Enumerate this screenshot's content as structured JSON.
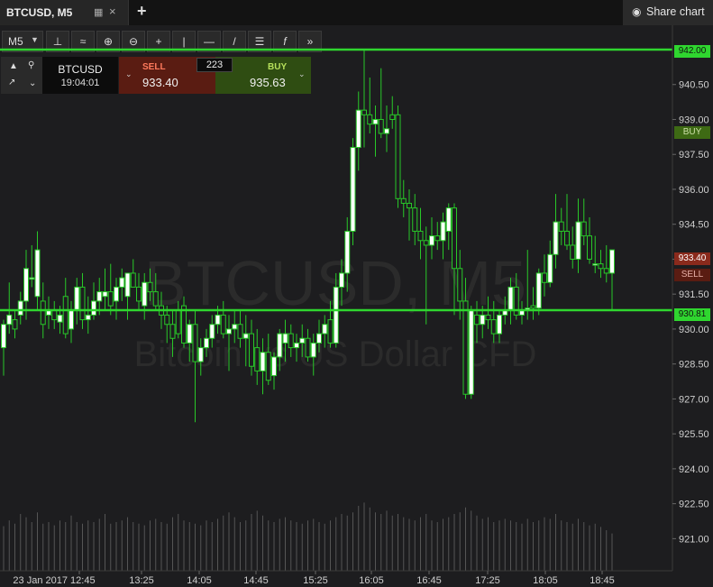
{
  "tab": {
    "title": "BTCUSD, M5",
    "grid_icon": "grid-icon",
    "close_label": "×"
  },
  "add_tab_label": "+",
  "share": {
    "icon": "camera-icon",
    "label": "Share chart"
  },
  "toolbar": {
    "timeframe": "M5",
    "tools": [
      "crosshair-axes-icon",
      "indicator-icon",
      "zoom-in-icon",
      "zoom-out-icon",
      "crosshair-icon",
      "vertical-line-icon",
      "horizontal-line-icon",
      "trend-line-icon",
      "fibonacci-icon",
      "function-icon",
      "fast-forward-icon"
    ]
  },
  "trade_panel": {
    "symbol": "BTCUSD",
    "time": "19:04:01",
    "sell_label": "SELL",
    "sell_price": "933.40",
    "buy_label": "BUY",
    "buy_price": "935.63",
    "spread": "223"
  },
  "watermark": {
    "line1": "BTCUSD, M5",
    "line2": "Bitcoin vs US Dollar CFD"
  },
  "colors": {
    "up": "#ffffff",
    "down": "#1d1d1f",
    "wick": "#28c828",
    "hline": "#2fd62f",
    "sell": "#8a2a1c",
    "buy": "#3e6a14",
    "background": "#1d1d1f"
  },
  "axis_tags": {
    "top": "942.00",
    "buy": "BUY",
    "sell_price": "933.40",
    "sell": "SELL",
    "bottom": "930.81"
  },
  "chart_data": {
    "type": "candlestick",
    "symbol": "BTCUSD, M5",
    "ylim": [
      920.4,
      943.0
    ],
    "y_ticks": [
      "940.50",
      "939.00",
      "937.50",
      "936.00",
      "934.50",
      "933.00",
      "931.50",
      "930.00",
      "928.50",
      "927.00",
      "925.50",
      "924.00",
      "922.50",
      "921.00"
    ],
    "x_ticks": [
      "23 Jan 2017 12:45",
      "13:25",
      "14:05",
      "14:45",
      "15:25",
      "16:05",
      "16:45",
      "17:25",
      "18:05",
      "18:45"
    ],
    "horizontal_lines": [
      942.0,
      930.81
    ],
    "candles": [
      {
        "o": 929.2,
        "h": 930.4,
        "l": 928.0,
        "c": 930.2
      },
      {
        "o": 930.2,
        "h": 932.0,
        "l": 929.8,
        "c": 930.6
      },
      {
        "o": 930.4,
        "h": 930.8,
        "l": 929.6,
        "c": 930.0
      },
      {
        "o": 930.6,
        "h": 931.6,
        "l": 930.2,
        "c": 931.2
      },
      {
        "o": 931.2,
        "h": 933.4,
        "l": 930.4,
        "c": 932.6
      },
      {
        "o": 932.2,
        "h": 933.6,
        "l": 931.8,
        "c": 932.2
      },
      {
        "o": 931.4,
        "h": 934.2,
        "l": 930.8,
        "c": 933.4
      },
      {
        "o": 931.2,
        "h": 932.0,
        "l": 929.6,
        "c": 930.2
      },
      {
        "o": 930.6,
        "h": 931.4,
        "l": 930.0,
        "c": 930.8
      },
      {
        "o": 930.8,
        "h": 931.2,
        "l": 930.0,
        "c": 930.4
      },
      {
        "o": 930.3,
        "h": 931.0,
        "l": 929.8,
        "c": 930.6
      },
      {
        "o": 931.4,
        "h": 932.2,
        "l": 929.6,
        "c": 929.8
      },
      {
        "o": 930.0,
        "h": 931.2,
        "l": 929.4,
        "c": 930.8
      },
      {
        "o": 930.8,
        "h": 932.2,
        "l": 930.2,
        "c": 931.8
      },
      {
        "o": 931.8,
        "h": 932.4,
        "l": 930.0,
        "c": 930.4
      },
      {
        "o": 930.4,
        "h": 931.4,
        "l": 929.8,
        "c": 930.6
      },
      {
        "o": 930.6,
        "h": 932.0,
        "l": 930.4,
        "c": 931.2
      },
      {
        "o": 931.2,
        "h": 932.2,
        "l": 930.6,
        "c": 931.6
      },
      {
        "o": 931.4,
        "h": 932.6,
        "l": 930.8,
        "c": 931.6
      },
      {
        "o": 931.6,
        "h": 932.8,
        "l": 930.6,
        "c": 931.0
      },
      {
        "o": 931.2,
        "h": 932.2,
        "l": 930.4,
        "c": 931.8
      },
      {
        "o": 931.8,
        "h": 932.6,
        "l": 931.2,
        "c": 932.2
      },
      {
        "o": 931.4,
        "h": 932.0,
        "l": 930.4,
        "c": 932.4
      },
      {
        "o": 932.4,
        "h": 933.0,
        "l": 931.8,
        "c": 931.8
      },
      {
        "o": 931.8,
        "h": 932.4,
        "l": 930.8,
        "c": 931.2
      },
      {
        "o": 931.0,
        "h": 932.4,
        "l": 930.4,
        "c": 932.0
      },
      {
        "o": 932.0,
        "h": 932.6,
        "l": 931.2,
        "c": 931.6
      },
      {
        "o": 931.6,
        "h": 932.4,
        "l": 930.8,
        "c": 931.0
      },
      {
        "o": 931.0,
        "h": 931.6,
        "l": 930.0,
        "c": 930.6
      },
      {
        "o": 930.6,
        "h": 931.0,
        "l": 929.4,
        "c": 930.2
      },
      {
        "o": 930.2,
        "h": 930.8,
        "l": 928.8,
        "c": 929.6
      },
      {
        "o": 930.8,
        "h": 931.2,
        "l": 929.6,
        "c": 929.8
      },
      {
        "o": 931.0,
        "h": 931.4,
        "l": 929.2,
        "c": 929.4
      },
      {
        "o": 929.4,
        "h": 930.4,
        "l": 928.6,
        "c": 930.2
      },
      {
        "o": 930.2,
        "h": 930.8,
        "l": 926.0,
        "c": 928.6
      },
      {
        "o": 928.6,
        "h": 929.6,
        "l": 928.0,
        "c": 929.2
      },
      {
        "o": 929.2,
        "h": 930.0,
        "l": 928.8,
        "c": 929.6
      },
      {
        "o": 929.6,
        "h": 930.6,
        "l": 929.2,
        "c": 930.2
      },
      {
        "o": 930.2,
        "h": 931.0,
        "l": 929.8,
        "c": 930.6
      },
      {
        "o": 930.6,
        "h": 931.2,
        "l": 929.6,
        "c": 929.8
      },
      {
        "o": 929.8,
        "h": 930.6,
        "l": 928.2,
        "c": 930.0
      },
      {
        "o": 930.0,
        "h": 930.8,
        "l": 929.4,
        "c": 930.2
      },
      {
        "o": 930.2,
        "h": 930.8,
        "l": 929.2,
        "c": 929.6
      },
      {
        "o": 929.6,
        "h": 930.6,
        "l": 928.4,
        "c": 929.8
      },
      {
        "o": 929.8,
        "h": 930.4,
        "l": 928.0,
        "c": 928.4
      },
      {
        "o": 929.2,
        "h": 930.0,
        "l": 927.6,
        "c": 928.2
      },
      {
        "o": 928.2,
        "h": 929.6,
        "l": 927.2,
        "c": 929.0
      },
      {
        "o": 929.0,
        "h": 929.8,
        "l": 927.6,
        "c": 927.8
      },
      {
        "o": 928.0,
        "h": 929.0,
        "l": 927.4,
        "c": 928.8
      },
      {
        "o": 928.8,
        "h": 930.0,
        "l": 928.2,
        "c": 929.8
      },
      {
        "o": 929.4,
        "h": 930.4,
        "l": 928.6,
        "c": 929.8
      },
      {
        "o": 929.8,
        "h": 930.2,
        "l": 928.8,
        "c": 929.2
      },
      {
        "o": 929.2,
        "h": 929.8,
        "l": 928.6,
        "c": 929.4
      },
      {
        "o": 929.4,
        "h": 930.2,
        "l": 928.8,
        "c": 929.6
      },
      {
        "o": 929.6,
        "h": 930.0,
        "l": 928.6,
        "c": 928.8
      },
      {
        "o": 928.8,
        "h": 929.8,
        "l": 928.0,
        "c": 929.4
      },
      {
        "o": 929.4,
        "h": 930.4,
        "l": 929.0,
        "c": 929.8
      },
      {
        "o": 929.8,
        "h": 930.6,
        "l": 929.2,
        "c": 930.2
      },
      {
        "o": 930.4,
        "h": 931.2,
        "l": 929.2,
        "c": 929.4
      },
      {
        "o": 929.4,
        "h": 932.4,
        "l": 929.2,
        "c": 931.8
      },
      {
        "o": 931.8,
        "h": 933.0,
        "l": 931.0,
        "c": 932.4
      },
      {
        "o": 932.4,
        "h": 934.8,
        "l": 931.6,
        "c": 934.2
      },
      {
        "o": 934.2,
        "h": 938.2,
        "l": 933.6,
        "c": 937.8
      },
      {
        "o": 937.8,
        "h": 940.2,
        "l": 936.8,
        "c": 939.4
      },
      {
        "o": 939.4,
        "h": 942.0,
        "l": 937.8,
        "c": 939.2
      },
      {
        "o": 939.2,
        "h": 940.8,
        "l": 938.4,
        "c": 938.8
      },
      {
        "o": 938.8,
        "h": 939.6,
        "l": 937.4,
        "c": 939.0
      },
      {
        "o": 939.0,
        "h": 941.2,
        "l": 938.2,
        "c": 938.4
      },
      {
        "o": 938.4,
        "h": 939.6,
        "l": 937.6,
        "c": 938.6
      },
      {
        "o": 939.2,
        "h": 940.0,
        "l": 938.6,
        "c": 939.0
      },
      {
        "o": 939.2,
        "h": 939.6,
        "l": 935.2,
        "c": 935.6
      },
      {
        "o": 935.6,
        "h": 936.4,
        "l": 934.8,
        "c": 935.4
      },
      {
        "o": 935.4,
        "h": 936.0,
        "l": 933.8,
        "c": 935.2
      },
      {
        "o": 935.2,
        "h": 935.8,
        "l": 933.6,
        "c": 934.2
      },
      {
        "o": 934.2,
        "h": 935.2,
        "l": 933.0,
        "c": 933.8
      },
      {
        "o": 933.8,
        "h": 934.4,
        "l": 930.2,
        "c": 933.6
      },
      {
        "o": 933.6,
        "h": 934.8,
        "l": 933.0,
        "c": 934.0
      },
      {
        "o": 934.0,
        "h": 934.6,
        "l": 933.4,
        "c": 933.8
      },
      {
        "o": 933.8,
        "h": 935.0,
        "l": 933.0,
        "c": 934.6
      },
      {
        "o": 934.2,
        "h": 935.4,
        "l": 933.4,
        "c": 935.2
      },
      {
        "o": 935.2,
        "h": 935.4,
        "l": 930.6,
        "c": 932.6
      },
      {
        "o": 932.6,
        "h": 933.4,
        "l": 930.4,
        "c": 931.2
      },
      {
        "o": 931.2,
        "h": 932.2,
        "l": 927.0,
        "c": 927.2
      },
      {
        "o": 927.2,
        "h": 931.0,
        "l": 927.0,
        "c": 930.8
      },
      {
        "o": 930.6,
        "h": 931.2,
        "l": 929.4,
        "c": 930.2
      },
      {
        "o": 930.2,
        "h": 931.0,
        "l": 929.6,
        "c": 930.6
      },
      {
        "o": 930.6,
        "h": 931.4,
        "l": 930.0,
        "c": 930.4
      },
      {
        "o": 930.4,
        "h": 931.2,
        "l": 929.4,
        "c": 929.8
      },
      {
        "o": 929.8,
        "h": 930.8,
        "l": 929.4,
        "c": 930.6
      },
      {
        "o": 930.6,
        "h": 931.4,
        "l": 930.2,
        "c": 930.8
      },
      {
        "o": 930.8,
        "h": 932.2,
        "l": 930.2,
        "c": 931.8
      },
      {
        "o": 931.8,
        "h": 932.4,
        "l": 930.4,
        "c": 930.6
      },
      {
        "o": 930.6,
        "h": 931.2,
        "l": 930.2,
        "c": 930.8
      },
      {
        "o": 930.8,
        "h": 933.4,
        "l": 930.4,
        "c": 930.9
      },
      {
        "o": 931.0,
        "h": 931.8,
        "l": 930.4,
        "c": 930.9
      },
      {
        "o": 930.9,
        "h": 932.6,
        "l": 930.6,
        "c": 932.4
      },
      {
        "o": 932.4,
        "h": 933.2,
        "l": 931.4,
        "c": 932.0
      },
      {
        "o": 932.0,
        "h": 933.8,
        "l": 931.8,
        "c": 933.2
      },
      {
        "o": 933.2,
        "h": 935.8,
        "l": 932.6,
        "c": 934.6
      },
      {
        "o": 934.6,
        "h": 935.2,
        "l": 933.6,
        "c": 934.2
      },
      {
        "o": 934.2,
        "h": 935.8,
        "l": 933.4,
        "c": 933.6
      },
      {
        "o": 933.6,
        "h": 934.4,
        "l": 932.6,
        "c": 933.0
      },
      {
        "o": 933.0,
        "h": 935.6,
        "l": 932.4,
        "c": 934.6
      },
      {
        "o": 934.6,
        "h": 935.6,
        "l": 933.6,
        "c": 934.0
      },
      {
        "o": 934.0,
        "h": 934.8,
        "l": 932.8,
        "c": 933.0
      },
      {
        "o": 932.8,
        "h": 934.0,
        "l": 932.4,
        "c": 932.8
      },
      {
        "o": 932.8,
        "h": 933.4,
        "l": 932.2,
        "c": 932.6
      },
      {
        "o": 932.6,
        "h": 933.6,
        "l": 932.0,
        "c": 932.4
      },
      {
        "o": 932.4,
        "h": 933.4,
        "l": 930.8,
        "c": 933.4
      }
    ],
    "volume": [
      0.55,
      0.62,
      0.58,
      0.7,
      0.66,
      0.6,
      0.72,
      0.58,
      0.6,
      0.56,
      0.62,
      0.6,
      0.68,
      0.6,
      0.58,
      0.62,
      0.6,
      0.64,
      0.7,
      0.58,
      0.6,
      0.62,
      0.66,
      0.6,
      0.58,
      0.56,
      0.62,
      0.64,
      0.6,
      0.58,
      0.66,
      0.7,
      0.62,
      0.6,
      0.58,
      0.56,
      0.62,
      0.6,
      0.64,
      0.68,
      0.72,
      0.66,
      0.6,
      0.62,
      0.7,
      0.74,
      0.68,
      0.62,
      0.6,
      0.64,
      0.66,
      0.62,
      0.6,
      0.58,
      0.62,
      0.64,
      0.6,
      0.58,
      0.62,
      0.66,
      0.7,
      0.68,
      0.72,
      0.8,
      0.84,
      0.78,
      0.72,
      0.7,
      0.74,
      0.68,
      0.7,
      0.66,
      0.64,
      0.62,
      0.66,
      0.7,
      0.62,
      0.6,
      0.64,
      0.66,
      0.7,
      0.72,
      0.78,
      0.74,
      0.68,
      0.64,
      0.66,
      0.6,
      0.62,
      0.64,
      0.62,
      0.6,
      0.58,
      0.64,
      0.6,
      0.62,
      0.66,
      0.64,
      0.7,
      0.62,
      0.6,
      0.58,
      0.64,
      0.6,
      0.56,
      0.58,
      0.54,
      0.5,
      0.46
    ]
  }
}
